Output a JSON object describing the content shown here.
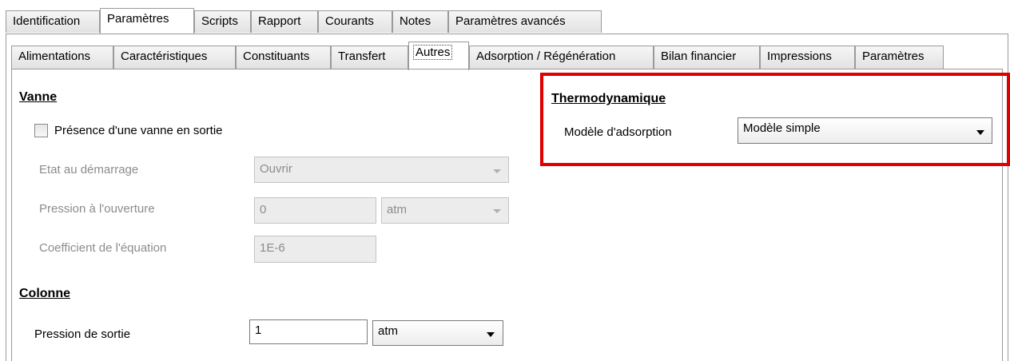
{
  "main_tabs": [
    {
      "label": "Identification",
      "active": false
    },
    {
      "label": "Paramètres",
      "active": true
    },
    {
      "label": "Scripts",
      "active": false
    },
    {
      "label": "Rapport",
      "active": false
    },
    {
      "label": "Courants",
      "active": false
    },
    {
      "label": "Notes",
      "active": false
    },
    {
      "label": "Paramètres avancés",
      "active": false
    }
  ],
  "sub_tabs": [
    {
      "label": "Alimentations",
      "active": false
    },
    {
      "label": "Caractéristiques",
      "active": false
    },
    {
      "label": "Constituants",
      "active": false
    },
    {
      "label": "Transfert",
      "active": false
    },
    {
      "label": "Autres",
      "active": true
    },
    {
      "label": "Adsorption / Régénération",
      "active": false
    },
    {
      "label": "Bilan financier",
      "active": false
    },
    {
      "label": "Impressions",
      "active": false
    },
    {
      "label": "Paramètres",
      "active": false
    }
  ],
  "vanne": {
    "title": "Vanne",
    "presence_label": "Présence d'une vanne en sortie",
    "presence_checked": false,
    "etat_label": "Etat au démarrage",
    "etat_value": "Ouvrir",
    "pression_label": "Pression à l'ouverture",
    "pression_value": "0",
    "pression_unit": "atm",
    "coeff_label": "Coefficient de l'équation",
    "coeff_value": "1E-6"
  },
  "colonne": {
    "title": "Colonne",
    "pression_label": "Pression de sortie",
    "pression_value": "1",
    "pression_unit": "atm"
  },
  "thermo": {
    "title": "Thermodynamique",
    "modele_label": "Modèle d'adsorption",
    "modele_value": "Modèle simple"
  },
  "colors": {
    "highlight": "#e00000",
    "disabled_text": "#8c8c8c"
  }
}
